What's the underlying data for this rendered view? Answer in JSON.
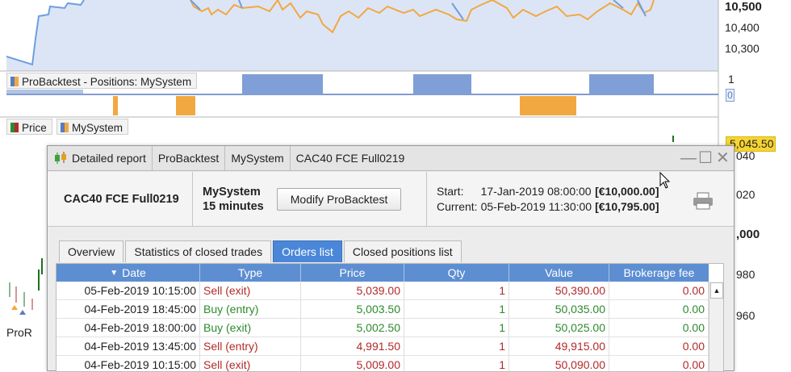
{
  "chart": {
    "axis_labels": [
      "10,500",
      "10,400",
      "10,300",
      "040",
      "020",
      ",000",
      "980",
      "960"
    ],
    "position_axis": [
      "1",
      "0"
    ],
    "price_tag": "5,045.50",
    "legend_positions": "ProBacktest - Positions: MySystem",
    "legend_price": "Price",
    "legend_system": "MySystem",
    "logo_fragment": "ProR",
    "colors": {
      "equity_line": "#f2a840",
      "price_line": "#6f9ee0",
      "position_bar": "#5a7cc0",
      "price_tag": "#f7d531"
    }
  },
  "window": {
    "title_segments": [
      "Detailed report",
      "ProBacktest",
      "MySystem",
      "CAC40 FCE Full0219"
    ],
    "controls": [
      "minimize",
      "maximize",
      "close"
    ],
    "instrument": "CAC40 FCE Full0219",
    "system_name": "MySystem",
    "timeframe": "15 minutes",
    "modify_button": "Modify ProBacktest",
    "start_label": "Start:",
    "start_value": "17-Jan-2019 08:00:00",
    "start_capital": "[€10,000.00]",
    "current_label": "Current:",
    "current_value": "05-Feb-2019 11:30:00",
    "current_capital": "[€10,795.00]",
    "print_icon": "printer-icon"
  },
  "tabs": [
    {
      "label": "Overview",
      "active": false
    },
    {
      "label": "Statistics of closed trades",
      "active": false
    },
    {
      "label": "Orders list",
      "active": true
    },
    {
      "label": "Closed positions list",
      "active": false
    }
  ],
  "orders_table": {
    "headers": [
      "Date",
      "Type",
      "Price",
      "Qty",
      "Value",
      "Brokerage fee"
    ],
    "sort_indicator": "▼",
    "rows": [
      {
        "date": "05-Feb-2019 10:15:00",
        "type": "Sell (exit)",
        "price": "5,039.00",
        "qty": "1",
        "value": "50,390.00",
        "fee": "0.00"
      },
      {
        "date": "04-Feb-2019 18:45:00",
        "type": "Buy (entry)",
        "price": "5,003.50",
        "qty": "1",
        "value": "50,035.00",
        "fee": "0.00"
      },
      {
        "date": "04-Feb-2019 18:00:00",
        "type": "Buy (exit)",
        "price": "5,002.50",
        "qty": "1",
        "value": "50,025.00",
        "fee": "0.00"
      },
      {
        "date": "04-Feb-2019 13:45:00",
        "type": "Sell (entry)",
        "price": "4,991.50",
        "qty": "1",
        "value": "49,915.00",
        "fee": "0.00"
      },
      {
        "date": "04-Feb-2019 10:15:00",
        "type": "Sell (exit)",
        "price": "5,009.00",
        "qty": "1",
        "value": "50,090.00",
        "fee": "0.00"
      }
    ]
  }
}
